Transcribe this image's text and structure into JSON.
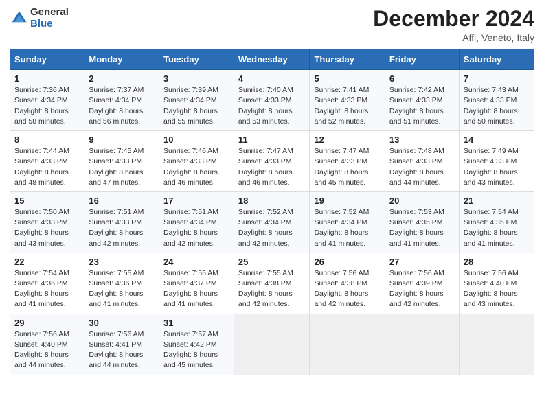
{
  "logo": {
    "general": "General",
    "blue": "Blue"
  },
  "title": "December 2024",
  "location": "Affi, Veneto, Italy",
  "days_of_week": [
    "Sunday",
    "Monday",
    "Tuesday",
    "Wednesday",
    "Thursday",
    "Friday",
    "Saturday"
  ],
  "weeks": [
    [
      {
        "day": "1",
        "sunrise": "7:36 AM",
        "sunset": "4:34 PM",
        "daylight": "8 hours and 58 minutes."
      },
      {
        "day": "2",
        "sunrise": "7:37 AM",
        "sunset": "4:34 PM",
        "daylight": "8 hours and 56 minutes."
      },
      {
        "day": "3",
        "sunrise": "7:39 AM",
        "sunset": "4:34 PM",
        "daylight": "8 hours and 55 minutes."
      },
      {
        "day": "4",
        "sunrise": "7:40 AM",
        "sunset": "4:33 PM",
        "daylight": "8 hours and 53 minutes."
      },
      {
        "day": "5",
        "sunrise": "7:41 AM",
        "sunset": "4:33 PM",
        "daylight": "8 hours and 52 minutes."
      },
      {
        "day": "6",
        "sunrise": "7:42 AM",
        "sunset": "4:33 PM",
        "daylight": "8 hours and 51 minutes."
      },
      {
        "day": "7",
        "sunrise": "7:43 AM",
        "sunset": "4:33 PM",
        "daylight": "8 hours and 50 minutes."
      }
    ],
    [
      {
        "day": "8",
        "sunrise": "7:44 AM",
        "sunset": "4:33 PM",
        "daylight": "8 hours and 48 minutes."
      },
      {
        "day": "9",
        "sunrise": "7:45 AM",
        "sunset": "4:33 PM",
        "daylight": "8 hours and 47 minutes."
      },
      {
        "day": "10",
        "sunrise": "7:46 AM",
        "sunset": "4:33 PM",
        "daylight": "8 hours and 46 minutes."
      },
      {
        "day": "11",
        "sunrise": "7:47 AM",
        "sunset": "4:33 PM",
        "daylight": "8 hours and 46 minutes."
      },
      {
        "day": "12",
        "sunrise": "7:47 AM",
        "sunset": "4:33 PM",
        "daylight": "8 hours and 45 minutes."
      },
      {
        "day": "13",
        "sunrise": "7:48 AM",
        "sunset": "4:33 PM",
        "daylight": "8 hours and 44 minutes."
      },
      {
        "day": "14",
        "sunrise": "7:49 AM",
        "sunset": "4:33 PM",
        "daylight": "8 hours and 43 minutes."
      }
    ],
    [
      {
        "day": "15",
        "sunrise": "7:50 AM",
        "sunset": "4:33 PM",
        "daylight": "8 hours and 43 minutes."
      },
      {
        "day": "16",
        "sunrise": "7:51 AM",
        "sunset": "4:33 PM",
        "daylight": "8 hours and 42 minutes."
      },
      {
        "day": "17",
        "sunrise": "7:51 AM",
        "sunset": "4:34 PM",
        "daylight": "8 hours and 42 minutes."
      },
      {
        "day": "18",
        "sunrise": "7:52 AM",
        "sunset": "4:34 PM",
        "daylight": "8 hours and 42 minutes."
      },
      {
        "day": "19",
        "sunrise": "7:52 AM",
        "sunset": "4:34 PM",
        "daylight": "8 hours and 41 minutes."
      },
      {
        "day": "20",
        "sunrise": "7:53 AM",
        "sunset": "4:35 PM",
        "daylight": "8 hours and 41 minutes."
      },
      {
        "day": "21",
        "sunrise": "7:54 AM",
        "sunset": "4:35 PM",
        "daylight": "8 hours and 41 minutes."
      }
    ],
    [
      {
        "day": "22",
        "sunrise": "7:54 AM",
        "sunset": "4:36 PM",
        "daylight": "8 hours and 41 minutes."
      },
      {
        "day": "23",
        "sunrise": "7:55 AM",
        "sunset": "4:36 PM",
        "daylight": "8 hours and 41 minutes."
      },
      {
        "day": "24",
        "sunrise": "7:55 AM",
        "sunset": "4:37 PM",
        "daylight": "8 hours and 41 minutes."
      },
      {
        "day": "25",
        "sunrise": "7:55 AM",
        "sunset": "4:38 PM",
        "daylight": "8 hours and 42 minutes."
      },
      {
        "day": "26",
        "sunrise": "7:56 AM",
        "sunset": "4:38 PM",
        "daylight": "8 hours and 42 minutes."
      },
      {
        "day": "27",
        "sunrise": "7:56 AM",
        "sunset": "4:39 PM",
        "daylight": "8 hours and 42 minutes."
      },
      {
        "day": "28",
        "sunrise": "7:56 AM",
        "sunset": "4:40 PM",
        "daylight": "8 hours and 43 minutes."
      }
    ],
    [
      {
        "day": "29",
        "sunrise": "7:56 AM",
        "sunset": "4:40 PM",
        "daylight": "8 hours and 44 minutes."
      },
      {
        "day": "30",
        "sunrise": "7:56 AM",
        "sunset": "4:41 PM",
        "daylight": "8 hours and 44 minutes."
      },
      {
        "day": "31",
        "sunrise": "7:57 AM",
        "sunset": "4:42 PM",
        "daylight": "8 hours and 45 minutes."
      },
      null,
      null,
      null,
      null
    ]
  ]
}
